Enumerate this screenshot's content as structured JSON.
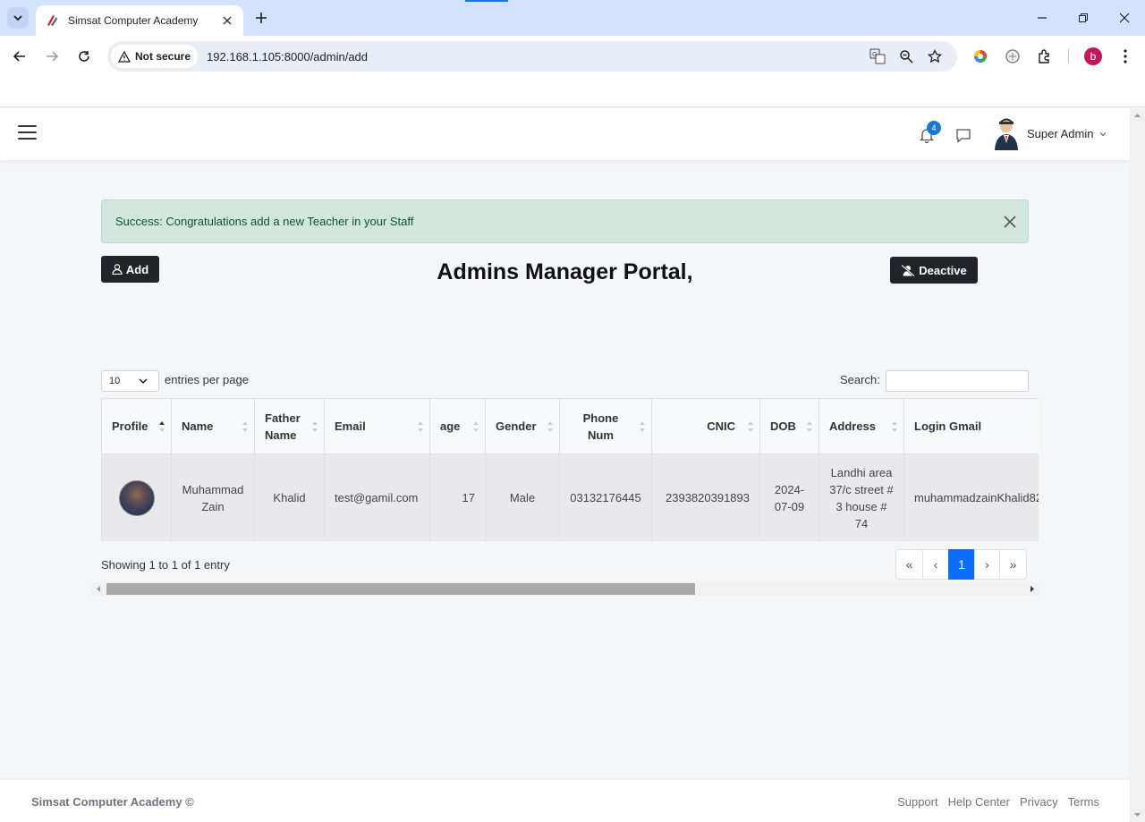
{
  "browser": {
    "tab_title": "Simsat Computer Academy",
    "security_label": "Not secure",
    "url": "192.168.1.105:8000/admin/add",
    "profile_initial": "b"
  },
  "header": {
    "notification_count": "4",
    "user_name": "Super Admin"
  },
  "alert": {
    "message": "Success: Congratulations add a new Teacher in your Staff"
  },
  "toolbar": {
    "add_label": "Add",
    "deactive_label": "Deactive"
  },
  "page_title": "Admins Manager Portal,",
  "table_controls": {
    "page_length": "10",
    "length_label": "entries per page",
    "search_label": "Search:"
  },
  "table": {
    "columns": [
      "Profile",
      "Name",
      "Father Name",
      "Email",
      "age",
      "Gender",
      "Phone Num",
      "CNIC",
      "DOB",
      "Address",
      "Login Gmail"
    ],
    "rows": [
      {
        "name": "Muhammad Zain",
        "father_name": "Khalid",
        "email": "test@gamil.com",
        "age": "17",
        "gender": "Male",
        "phone": "03132176445",
        "cnic": "2393820391893",
        "dob": "2024-07-09",
        "address": "Landhi area 37/c street # 3 house # 74",
        "login_gmail": "muhammadzainKhalid82"
      }
    ]
  },
  "table_info": "Showing 1 to 1 of 1 entry",
  "pagination": {
    "first": "«",
    "prev": "‹",
    "current": "1",
    "next": "›",
    "last": "»"
  },
  "footer": {
    "brand": "Simsat Computer Academy ©",
    "links": [
      "Support",
      "Help Center",
      "Privacy",
      "Terms"
    ]
  },
  "colors": {
    "tabstrip": "#d3e3fd",
    "alert_bg": "#d1e7dd",
    "alert_text": "#0f5132",
    "primary": "#0d6efd",
    "dark_button": "#212529"
  }
}
